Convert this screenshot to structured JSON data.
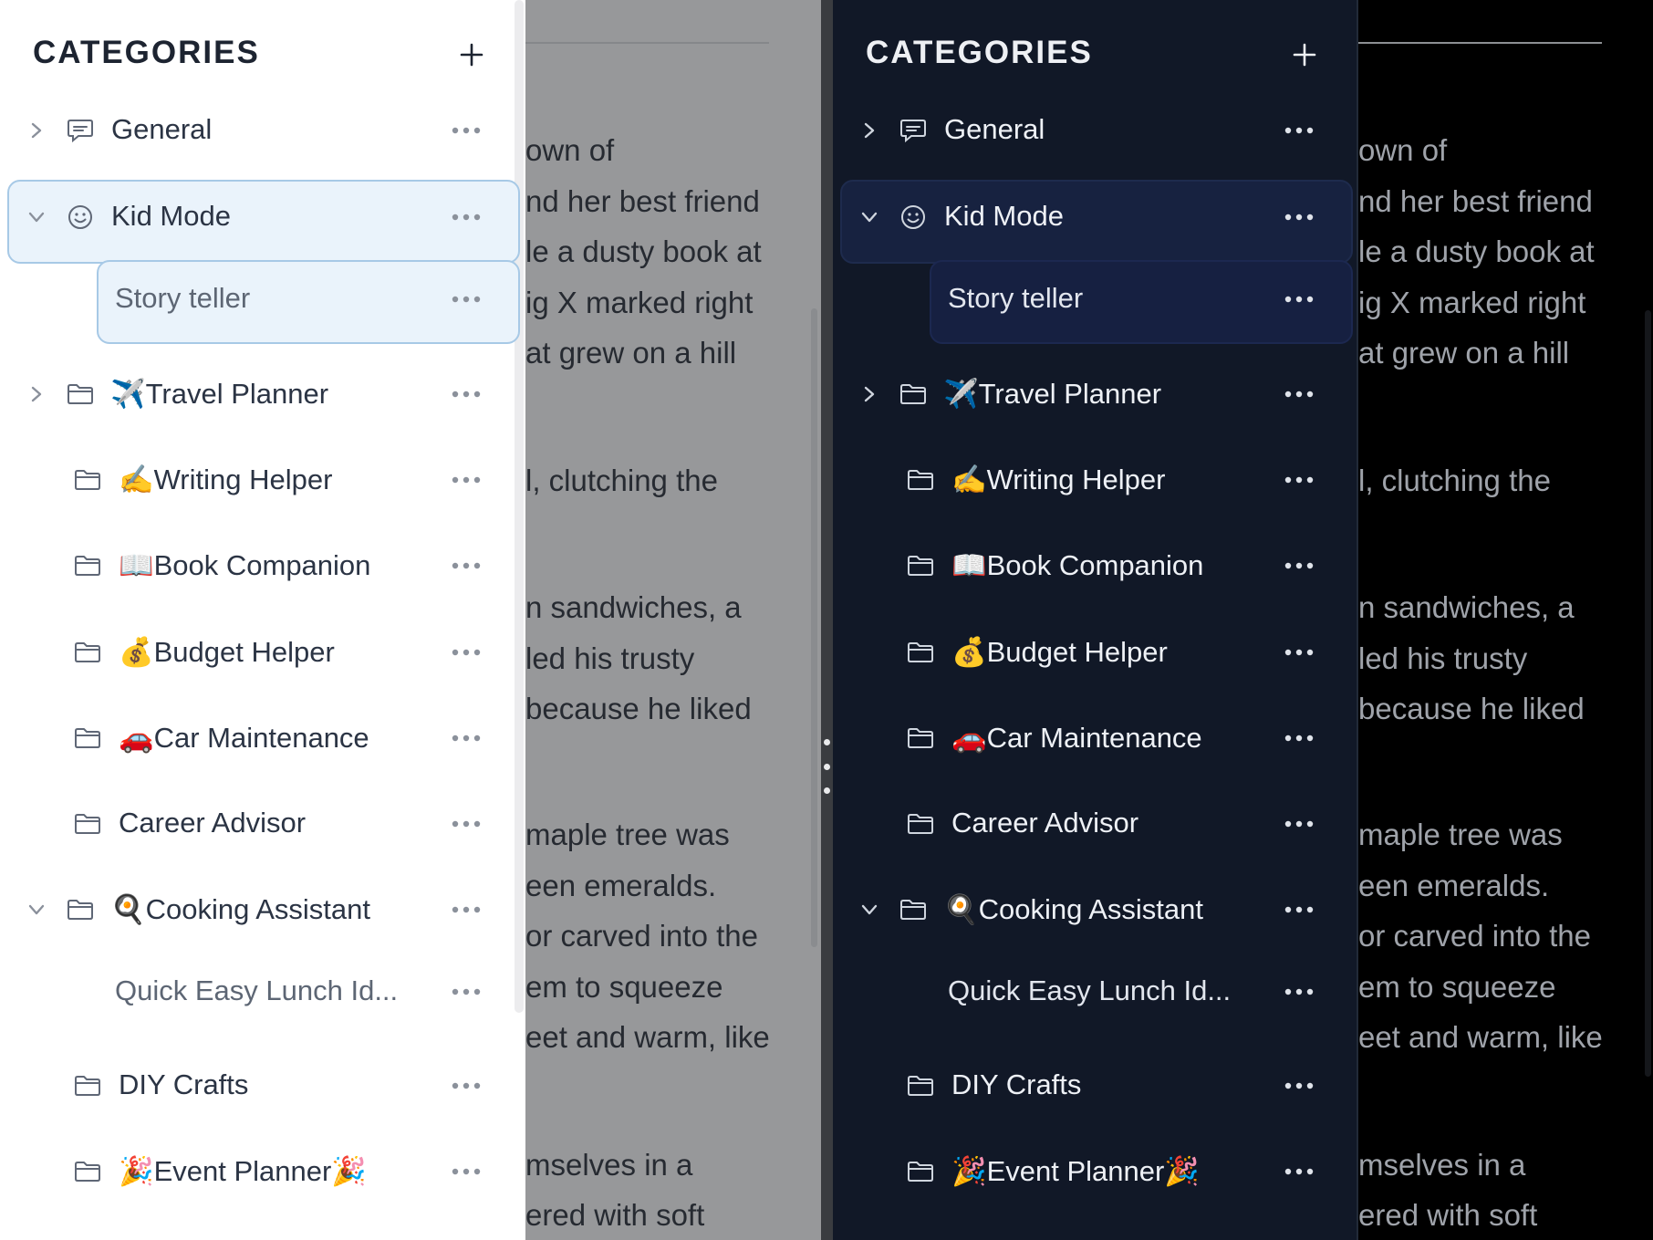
{
  "sidebar": {
    "title": "CATEGORIES",
    "items": [
      {
        "label": "General",
        "kind": "chat",
        "expandable": true,
        "expanded": false
      },
      {
        "label": "Kid Mode",
        "kind": "smiley",
        "expandable": true,
        "expanded": true,
        "selected": true
      },
      {
        "label": "Story teller",
        "kind": "child",
        "selected": true
      },
      {
        "label": "✈️Travel Planner",
        "kind": "folder",
        "expandable": true,
        "expanded": false
      },
      {
        "label": "✍️Writing Helper",
        "kind": "folder"
      },
      {
        "label": "📖Book Companion",
        "kind": "folder"
      },
      {
        "label": "💰Budget Helper",
        "kind": "folder"
      },
      {
        "label": "🚗Car Maintenance",
        "kind": "folder"
      },
      {
        "label": "Career Advisor",
        "kind": "folder"
      },
      {
        "label": "🍳Cooking Assistant",
        "kind": "folder",
        "expandable": true,
        "expanded": true
      },
      {
        "label": "Quick Easy Lunch Id...",
        "kind": "child"
      },
      {
        "label": "DIY Crafts",
        "kind": "folder"
      },
      {
        "label": "🎉Event Planner🎉",
        "kind": "folder"
      }
    ]
  },
  "story": {
    "lines": [
      "own of",
      "nd her best friend",
      "le a dusty book at",
      "ig X marked right",
      "at grew on a hill",
      "l, clutching the",
      "n sandwiches, a",
      "led his trusty",
      " because he liked",
      "maple tree was",
      "een emeralds.",
      "or carved into the",
      "em to squeeze",
      "eet and warm, like",
      "mselves in a",
      "ered with soft"
    ]
  },
  "icons": {
    "add": "plus-icon",
    "more": "more-horizontal-icon",
    "expand": "chevron-right-icon",
    "collapse": "chevron-down-icon",
    "chat": "chat-bubble-icon",
    "smiley": "smiley-icon",
    "folder": "folder-icon"
  },
  "colors": {
    "light_selected_bg": "#eaf3fb",
    "light_selected_border": "#a7c9e6",
    "dark_bg": "#111827",
    "dark_selected_bg": "#172240"
  }
}
